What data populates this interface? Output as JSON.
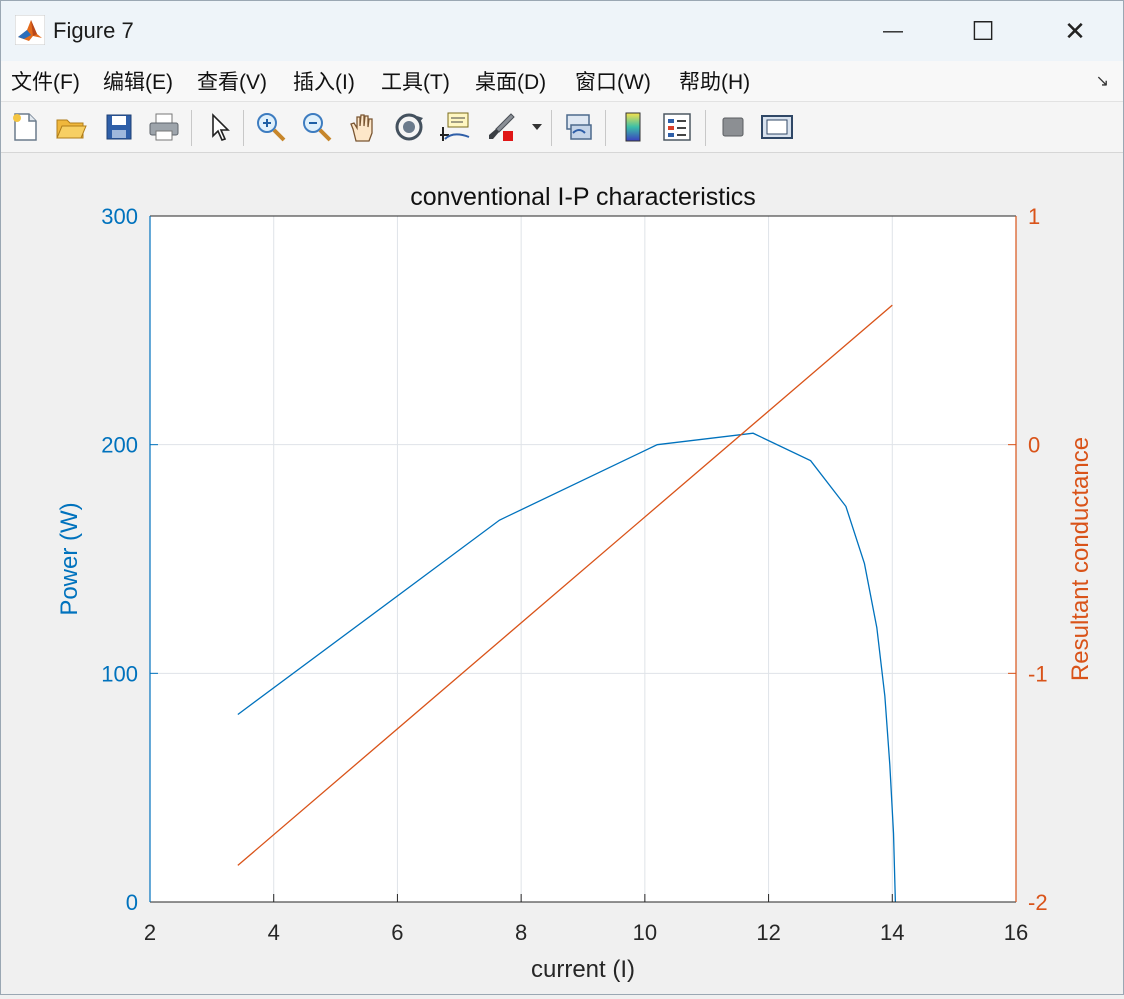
{
  "window": {
    "title": "Figure 7",
    "controls": {
      "minimize": "—",
      "maximize": "☐",
      "close": "✕"
    }
  },
  "menu": {
    "items": [
      "文件(F)",
      "编辑(E)",
      "查看(V)",
      "插入(I)",
      "工具(T)",
      "桌面(D)",
      "窗口(W)",
      "帮助(H)"
    ]
  },
  "toolbar": {
    "icons": [
      "new-figure-icon",
      "open-file-icon",
      "save-icon",
      "print-icon",
      "select-arrow-icon",
      "zoom-in-icon",
      "zoom-out-icon",
      "pan-hand-icon",
      "rotate-3d-icon",
      "data-cursor-icon",
      "brush-icon",
      "link-plot-icon",
      "colorbar-icon",
      "legend-icon",
      "hide-plot-tools-icon",
      "show-plot-tools-icon"
    ]
  },
  "colors": {
    "left_axis": "#0072BD",
    "right_axis": "#D95319",
    "grid": "#dfe3e8",
    "axes_text": "#262626"
  },
  "chart_data": {
    "type": "line",
    "title": "conventional I-P characteristics",
    "xlabel": "current (I)",
    "ylabel_left": "Power (W)",
    "ylabel_right": "Resultant conductance",
    "xlim": [
      2,
      16
    ],
    "ylim_left": [
      0,
      300
    ],
    "ylim_right": [
      -2,
      1
    ],
    "xticks": [
      "2",
      "4",
      "6",
      "8",
      "10",
      "12",
      "14",
      "16"
    ],
    "yticks_left": [
      "0",
      "100",
      "200",
      "300"
    ],
    "yticks_right": [
      "-2",
      "-1",
      "0",
      "1"
    ],
    "grid": true,
    "series": [
      {
        "axis": "left",
        "color": "#0072BD",
        "x": [
          3.42,
          7.65,
          10.2,
          11.75,
          12.68,
          13.25,
          13.55,
          13.75,
          13.88,
          13.96,
          14.02,
          14.05
        ],
        "y": [
          82,
          167,
          200,
          205,
          193,
          173,
          148,
          120,
          90,
          60,
          30,
          0
        ]
      },
      {
        "axis": "right",
        "color": "#D95319",
        "x": [
          3.42,
          14.0
        ],
        "y": [
          -1.84,
          0.61
        ]
      }
    ]
  }
}
